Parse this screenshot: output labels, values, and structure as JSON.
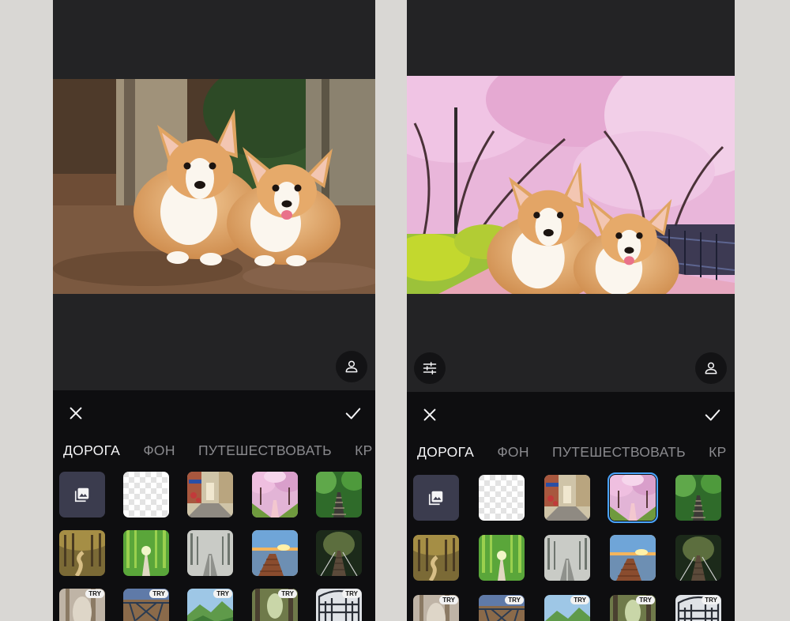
{
  "left_screen": {
    "tabs": [
      {
        "label": "ДОРОГА",
        "active": true
      },
      {
        "label": "ФОН",
        "active": false
      },
      {
        "label": "ПУТЕШЕСТВОВАТЬ",
        "active": false
      },
      {
        "label": "КР",
        "active": false
      }
    ],
    "try_badge": "TRY",
    "icons": [
      "close-icon",
      "check-icon",
      "person-icon",
      "gallery-icon"
    ]
  },
  "right_screen": {
    "tabs": [
      {
        "label": "ДОРОГА",
        "active": true
      },
      {
        "label": "ФОН",
        "active": false
      },
      {
        "label": "ПУТЕШЕСТВОВАТЬ",
        "active": false
      },
      {
        "label": "КР",
        "active": false
      }
    ],
    "try_badge": "TRY",
    "selected_thumbnail": "cherry-blossom-path",
    "icons": [
      "close-icon",
      "check-icon",
      "person-icon",
      "adjust-sliders-icon",
      "gallery-icon"
    ]
  },
  "colors": {
    "screen_bg": "#232325",
    "panel_bg": "#0e0e10",
    "tab_active": "#f4f4f6",
    "tab_inactive": "#8a8a8e",
    "selection": "#4aa4ff"
  }
}
